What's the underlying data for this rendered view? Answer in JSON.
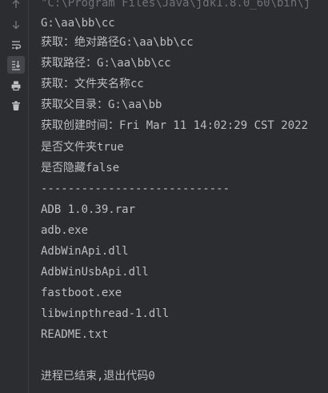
{
  "console": {
    "command": "\"C:\\Program Files\\Java\\jdk1.8.0_60\\bin\\j",
    "lines": [
      "G:\\aa\\bb\\cc",
      "获取：绝对路径G:\\aa\\bb\\cc",
      "获取路径：G:\\aa\\bb\\cc",
      "获取：文件夹名称cc",
      "获取父目录：G:\\aa\\bb",
      "获取创建时间：Fri Mar 11 14:02:29 CST 2022",
      "是否文件夹true",
      "是否隐藏false",
      "----------------------------",
      "ADB 1.0.39.rar",
      "adb.exe",
      "AdbWinApi.dll",
      "AdbWinUsbApi.dll",
      "fastboot.exe",
      "libwinpthread-1.dll",
      "README.txt",
      "",
      "进程已结束,退出代码0"
    ]
  },
  "toolbar": {
    "icons": [
      "up-arrow-icon",
      "down-arrow-icon",
      "soft-wrap-icon",
      "scroll-to-end-icon",
      "print-icon",
      "trash-icon"
    ]
  }
}
